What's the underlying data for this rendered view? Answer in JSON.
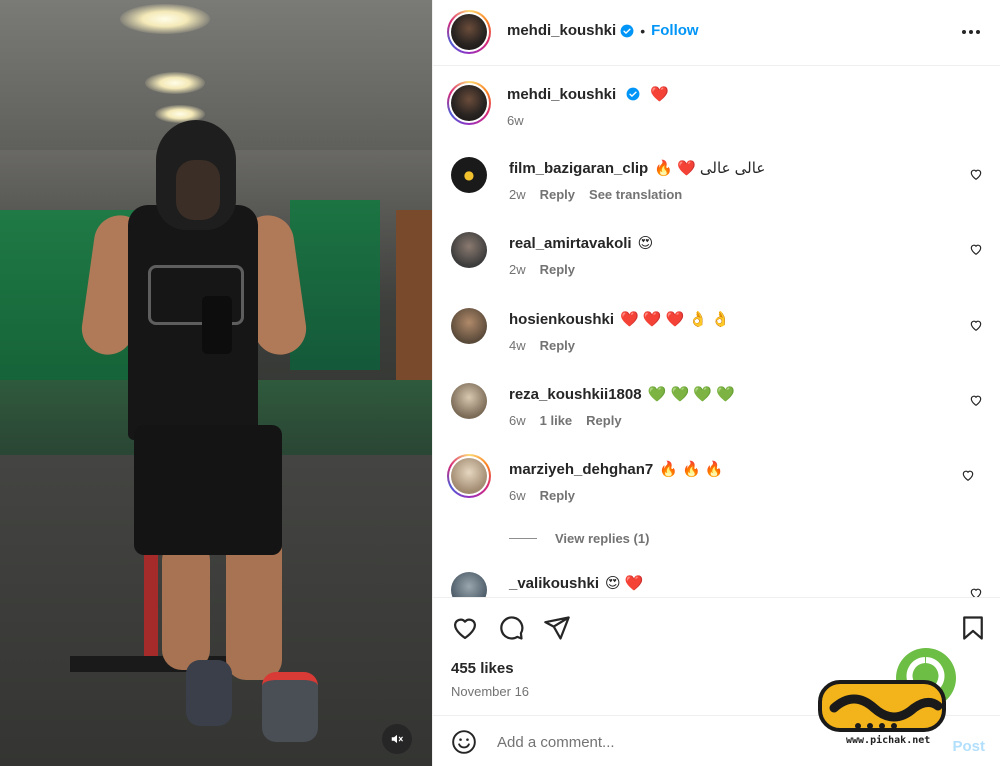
{
  "post": {
    "username": "mehdi_koushki",
    "follow_label": "Follow",
    "dot": "•",
    "caption_emoji": "❤️",
    "caption_time": "6w"
  },
  "comments": [
    {
      "username": "film_bazigaran_clip",
      "text": "🔥 ❤️ عالی عالی",
      "time": "2w",
      "likes": "",
      "reply": "Reply",
      "translate": "See translation",
      "avatar_color": "#1a1a1a"
    },
    {
      "username": "real_amirtavakoli",
      "text": "😍",
      "time": "2w",
      "likes": "",
      "reply": "Reply",
      "translate": "",
      "avatar_color": "#4b4b4b"
    },
    {
      "username": "hosienkoushki",
      "text": "❤️ ❤️ ❤️ 👌 👌",
      "time": "4w",
      "likes": "",
      "reply": "Reply",
      "translate": "",
      "avatar_color": "#6a5a4a"
    },
    {
      "username": "reza_koushkii1808",
      "text": "💚 💚 💚 💚",
      "time": "6w",
      "likes": "1 like",
      "reply": "Reply",
      "translate": "",
      "avatar_color": "#8a7a66"
    },
    {
      "username": "marziyeh_dehghan7",
      "text": "🔥 🔥 🔥",
      "time": "6w",
      "likes": "",
      "reply": "Reply",
      "translate": "",
      "avatar_color": "#c9b8a0"
    },
    {
      "username": "_valikoushki",
      "text": "😍 ❤️",
      "time": "",
      "likes": "",
      "reply": "",
      "translate": "",
      "avatar_color": "#5c6e7a"
    }
  ],
  "view_replies": "View replies (1)",
  "likes_label": "455 likes",
  "date_label": "November 16",
  "add_comment": {
    "placeholder": "Add a comment...",
    "post_label": "Post"
  },
  "watermark": {
    "url": "www.pichak.net"
  },
  "colors": {
    "accent": "#0095f6",
    "verified": "#0095f6",
    "muted": "#737373",
    "post_disabled": "#b2dffc"
  }
}
